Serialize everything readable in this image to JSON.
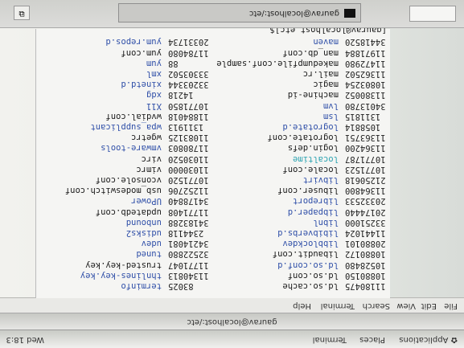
{
  "panel": {
    "applications": "Applications",
    "places": "Places",
    "terminal": "Terminal",
    "clock": "Wed 18:3"
  },
  "window": {
    "title": "gaurav@localhost:/etc",
    "tab_title": "gaurav@localhost:/etc"
  },
  "menu": [
    "File",
    "Edit",
    "View",
    "Search",
    "Terminal",
    "Help"
  ],
  "listing": [
    {
      "n1": "11180475",
      "f1": "ld.so.cache",
      "t1": "",
      "n2": "83025",
      "f2": "terminfo",
      "t2": "dir"
    },
    {
      "n1": "10880150",
      "f1": "ld.so.conf",
      "t1": "",
      "n2": "11340813",
      "f2": "thnlines-key.key",
      "t2": "dir"
    },
    {
      "n1": "10528480",
      "f1": "ld.so.conf.d",
      "t1": "dir",
      "n2": "11771047",
      "f2": "trusted-key.key",
      "t2": ""
    },
    {
      "n1": "10880172",
      "f1": "libaudit.conf",
      "t1": "",
      "n2": "32522880",
      "f2": "tuned",
      "t2": "dir"
    },
    {
      "n1": "20880101",
      "f1": "libblockdev",
      "t1": "dir",
      "n2": "34214081",
      "f2": "udev",
      "t2": "dir"
    },
    {
      "n1": "11441024",
      "f1": "libibverbs.d",
      "t1": "dir",
      "n2": "2344118",
      "f2": "udisks2",
      "t2": "dir"
    },
    {
      "n1": "33251000",
      "f1": "libnl",
      "t1": "dir",
      "n2": "34183288",
      "f2": "unbound",
      "t2": "dir"
    },
    {
      "n1": "20174440",
      "f1": "libpaper.d",
      "t1": "dir",
      "n2": "11771408",
      "f2": "updatedb.conf",
      "t2": ""
    },
    {
      "n1": "20332533",
      "f1": "libreport",
      "t1": "dir",
      "n2": "34178840",
      "f2": "UPower",
      "t2": "dir"
    },
    {
      "n1": "11364800",
      "f1": "libuser.conf",
      "t1": "",
      "n2": "11252706",
      "f2": "usb_modeswitch.conf",
      "t2": ""
    },
    {
      "n1": "21250618",
      "f1": "libvirt",
      "t1": "dir",
      "n2": "10771520",
      "f2": "vconsole.conf",
      "t2": ""
    },
    {
      "n1": "10771523",
      "f1": "locale.conf",
      "t1": "",
      "n2": "11030000",
      "f2": "vimrc",
      "t2": ""
    },
    {
      "n1": "10771787",
      "f1": "localtime",
      "t1": "lnk",
      "n2": "11030520",
      "f2": "virc",
      "t2": ""
    },
    {
      "n1": "11364200",
      "f1": "login.defs",
      "t1": "",
      "n2": "11780803",
      "f2": "vmware-tools",
      "t2": "dir"
    },
    {
      "n1": "11363751",
      "f1": "logrotate.conf",
      "t1": "",
      "n2": "11083125",
      "f2": "wgetrc",
      "t2": ""
    },
    {
      "n1": "1058814",
      "f1": "logrotate.d",
      "t1": "dir",
      "n2": "1311913",
      "f2": "wpa_supplicant",
      "t2": "dir"
    },
    {
      "n1": "1311815",
      "f1": "lsm",
      "t1": "dir",
      "n2": "11884018",
      "f2": "wvdial.conf",
      "t2": ""
    },
    {
      "n1": "34013780",
      "f1": "lvm",
      "t1": "dir",
      "n2": "10771850",
      "f2": "X11",
      "t2": "dir"
    },
    {
      "n1": "11380052",
      "f1": "machine-id",
      "t1": "",
      "n2": "14218",
      "f2": "xdg",
      "t2": "dir"
    },
    {
      "n1": "10803254",
      "f1": "magic",
      "t1": "",
      "n2": "33203344",
      "f2": "xinetd.d",
      "t2": "dir"
    },
    {
      "n1": "11362502",
      "f1": "mail.rc",
      "t1": "",
      "n2": "33303502",
      "f2": "xml",
      "t2": "dir"
    },
    {
      "n1": "11472980",
      "f1": "makedumpfile.conf.sample",
      "t1": "",
      "n2": "88",
      "f2": "yum",
      "t2": "dir"
    },
    {
      "n1": "11971884",
      "f1": "man_db.conf",
      "t1": "",
      "n2": "11784080",
      "f2": "yum.conf",
      "t2": ""
    },
    {
      "n1": "34418520",
      "f1": "maven",
      "t1": "dir",
      "n2": "20331734",
      "f2": "yum.repos.d",
      "t2": "dir"
    }
  ],
  "prompt": "[gaurav@localhost etc]$",
  "colors": {
    "directory": "#2f4fa8",
    "symlink": "#2aa2b0",
    "text": "#1a1a1a"
  }
}
